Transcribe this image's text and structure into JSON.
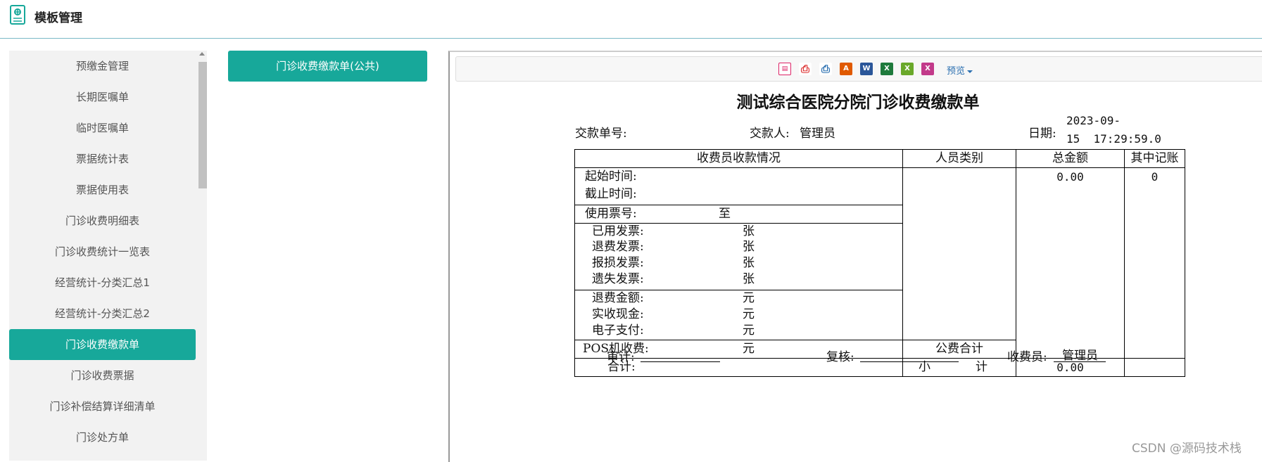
{
  "header": {
    "title": "模板管理"
  },
  "sidebar": {
    "items": [
      {
        "label": "预缴金管理",
        "active": false
      },
      {
        "label": "长期医嘱单",
        "active": false
      },
      {
        "label": "临时医嘱单",
        "active": false
      },
      {
        "label": "票据统计表",
        "active": false
      },
      {
        "label": "票据使用表",
        "active": false
      },
      {
        "label": "门诊收费明细表",
        "active": false
      },
      {
        "label": "门诊收费统计一览表",
        "active": false
      },
      {
        "label": "经营统计-分类汇总1",
        "active": false
      },
      {
        "label": "经营统计-分类汇总2",
        "active": false
      },
      {
        "label": "门诊收费缴款单",
        "active": true
      },
      {
        "label": "门诊收费票据",
        "active": false
      },
      {
        "label": "门诊补偿结算详细清单",
        "active": false
      },
      {
        "label": "门诊处方单",
        "active": false
      }
    ]
  },
  "template_list": {
    "selected": "门诊收费缴款单(公共)"
  },
  "toolbar": {
    "icons": [
      "page-setup-icon",
      "print-icon",
      "printer-icon",
      "pdf-icon",
      "word-icon",
      "excel-icon",
      "excel-alt-icon",
      "excel-xml-icon"
    ],
    "preview_label": "预览"
  },
  "doc": {
    "title": "测试综合医院分院门诊收费缴款单",
    "pay_no_label": "交款单号:",
    "payer_label": "交款人:",
    "payer_value": "管理员",
    "date_label": "日期:",
    "date_value_1": "2023-09-",
    "date_value_2": "15  17:29:59.0",
    "table": {
      "h1": "收费员收款情况",
      "h2": "人员类别",
      "h3": "总金额",
      "h4": "其中记账",
      "start_time": "起始时间:",
      "end_time": "截止时间:",
      "ticket_no": "使用票号:",
      "to": "至",
      "used": "已用发票:",
      "refund_inv": "退费发票:",
      "damaged": "报损发票:",
      "lost": "遗失发票:",
      "unit_zhang": "张",
      "refund_amt": "退费金额:",
      "cash": "实收现金:",
      "epay": "电子支付:",
      "pos": "POS机收费:",
      "unit_yuan": "元",
      "public_total": "公费合计",
      "total_label": "合计:",
      "subtotal_1": "小",
      "subtotal_2": "计",
      "total_amount": "0.00",
      "bookkeeping": "0",
      "subtotal_amount": "0.00"
    },
    "audit_label": "审计:",
    "review_label": "复核:",
    "cashier_label": "收费员:",
    "cashier_value": "管理员"
  },
  "watermark": "CSDN @源码技术栈",
  "colors": {
    "accent": "#17a89a",
    "header_line": "#7ab8c6"
  }
}
